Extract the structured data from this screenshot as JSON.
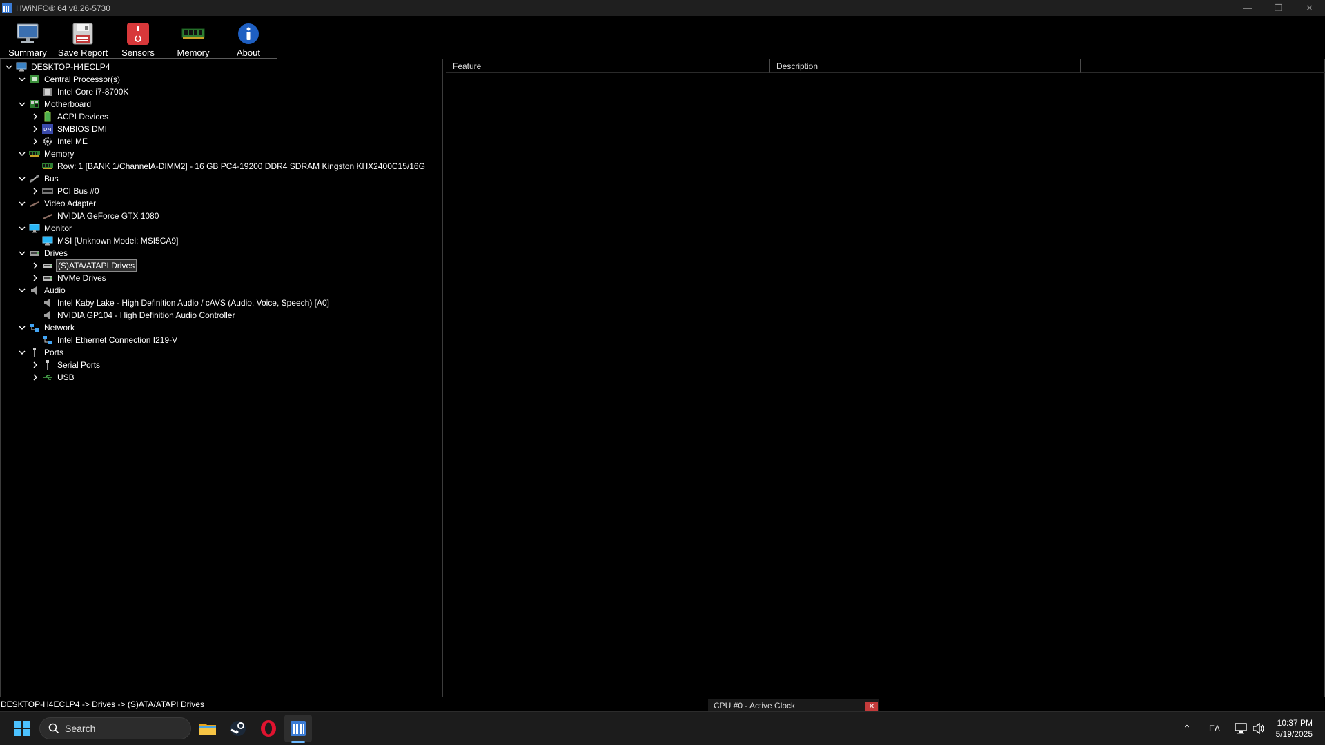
{
  "window": {
    "title": "HWiNFO® 64 v8.26-5730"
  },
  "toolbar": {
    "buttons": [
      {
        "label": "Summary",
        "icon": "monitor-icon"
      },
      {
        "label": "Save Report",
        "icon": "floppy-disk-icon"
      },
      {
        "label": "Sensors",
        "icon": "thermometer-icon"
      },
      {
        "label": "Memory",
        "icon": "memory-module-icon"
      },
      {
        "label": "About",
        "icon": "info-icon"
      }
    ]
  },
  "tree": {
    "nodes": [
      {
        "label": "DESKTOP-H4ECLP4",
        "level": 0,
        "expander": "down",
        "icon": "computer-icon"
      },
      {
        "label": "Central Processor(s)",
        "level": 1,
        "expander": "down",
        "icon": "cpu-icon"
      },
      {
        "label": "Intel Core i7-8700K",
        "level": 2,
        "expander": "none",
        "icon": "cpu-chip-icon"
      },
      {
        "label": "Motherboard",
        "level": 1,
        "expander": "down",
        "icon": "motherboard-icon"
      },
      {
        "label": "ACPI Devices",
        "level": 2,
        "expander": "right",
        "icon": "battery-icon"
      },
      {
        "label": "SMBIOS DMI",
        "level": 2,
        "expander": "right",
        "icon": "dmi-icon"
      },
      {
        "label": "Intel ME",
        "level": 2,
        "expander": "right",
        "icon": "gear-icon"
      },
      {
        "label": "Memory",
        "level": 1,
        "expander": "down",
        "icon": "ram-icon"
      },
      {
        "label": "Row: 1 [BANK 1/ChannelA-DIMM2] - 16 GB PC4-19200 DDR4 SDRAM Kingston KHX2400C15/16G",
        "level": 2,
        "expander": "none",
        "icon": "ram-stick-icon"
      },
      {
        "label": "Bus",
        "level": 1,
        "expander": "down",
        "icon": "bus-icon"
      },
      {
        "label": "PCI Bus #0",
        "level": 2,
        "expander": "right",
        "icon": "pci-bus-icon"
      },
      {
        "label": "Video Adapter",
        "level": 1,
        "expander": "down",
        "icon": "gpu-icon"
      },
      {
        "label": "NVIDIA GeForce GTX 1080",
        "level": 2,
        "expander": "none",
        "icon": "gpu-card-icon"
      },
      {
        "label": "Monitor",
        "level": 1,
        "expander": "down",
        "icon": "display-icon"
      },
      {
        "label": "MSI [Unknown Model: MSI5CA9]",
        "level": 2,
        "expander": "none",
        "icon": "display-icon"
      },
      {
        "label": "Drives",
        "level": 1,
        "expander": "down",
        "icon": "drives-icon"
      },
      {
        "label": "(S)ATA/ATAPI Drives",
        "level": 2,
        "expander": "right",
        "icon": "hard-drive-icon",
        "selected": true
      },
      {
        "label": "NVMe Drives",
        "level": 2,
        "expander": "right",
        "icon": "hard-drive-icon"
      },
      {
        "label": "Audio",
        "level": 1,
        "expander": "down",
        "icon": "speaker-icon"
      },
      {
        "label": "Intel Kaby Lake - High Definition Audio / cAVS (Audio, Voice, Speech) [A0]",
        "level": 2,
        "expander": "none",
        "icon": "speaker-icon"
      },
      {
        "label": "NVIDIA GP104 - High Definition Audio Controller",
        "level": 2,
        "expander": "none",
        "icon": "speaker-icon"
      },
      {
        "label": "Network",
        "level": 1,
        "expander": "down",
        "icon": "network-icon"
      },
      {
        "label": "Intel Ethernet Connection I219-V",
        "level": 2,
        "expander": "none",
        "icon": "network-adapter-icon"
      },
      {
        "label": "Ports",
        "level": 1,
        "expander": "down",
        "icon": "port-icon"
      },
      {
        "label": "Serial Ports",
        "level": 2,
        "expander": "right",
        "icon": "serial-port-icon"
      },
      {
        "label": "USB",
        "level": 2,
        "expander": "right",
        "icon": "usb-icon"
      }
    ]
  },
  "details": {
    "columns": [
      "Feature",
      "Description"
    ]
  },
  "status": {
    "path": "DESKTOP-H4ECLP4 -> Drives -> (S)ATA/ATAPI Drives",
    "popup_text": "CPU #0 - Active Clock"
  },
  "taskbar": {
    "search_placeholder": "Search",
    "language": "ΕΛ",
    "time": "10:37 PM",
    "date": "5/19/2025",
    "pinned": [
      {
        "icon": "start-icon"
      },
      {
        "icon": "file-explorer-icon"
      },
      {
        "icon": "steam-icon"
      },
      {
        "icon": "opera-icon"
      },
      {
        "icon": "hwinfo-icon",
        "active": true
      }
    ]
  },
  "colors": {
    "accent": "#6cb8ff",
    "selection_bg": "#2e2e2e",
    "close_red": "#c43b3b"
  }
}
